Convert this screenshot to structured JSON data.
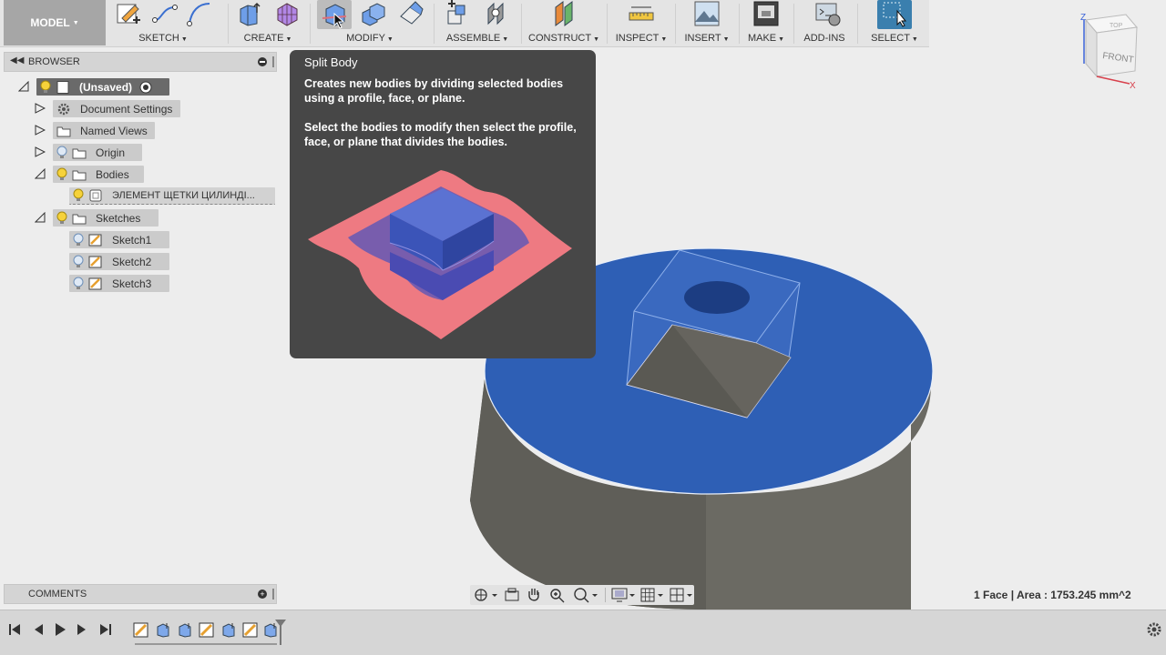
{
  "toolbar": {
    "workspace": "MODEL",
    "groups": {
      "sketch": "SKETCH",
      "create": "CREATE",
      "modify": "MODIFY",
      "assemble": "ASSEMBLE",
      "construct": "CONSTRUCT",
      "inspect": "INSPECT",
      "insert": "INSERT",
      "make": "MAKE",
      "addins": "ADD-INS",
      "select": "SELECT"
    }
  },
  "viewcube": {
    "top": "TOP",
    "front": "FRONT",
    "x": "X",
    "z": "Z"
  },
  "browser": {
    "title": "BROWSER",
    "items": {
      "root": "(Unsaved)",
      "doc_settings": "Document Settings",
      "named_views": "Named Views",
      "origin": "Origin",
      "bodies": "Bodies",
      "body1": "ЭЛЕМЕНТ ЩЕТКИ ЦИЛИНДІ...",
      "sketches": "Sketches",
      "sketch1": "Sketch1",
      "sketch2": "Sketch2",
      "sketch3": "Sketch3"
    }
  },
  "comments": {
    "title": "COMMENTS"
  },
  "tooltip": {
    "title": "Split Body",
    "description": "Creates new bodies by dividing selected bodies using a profile, face, or plane.",
    "instruction": "Select the bodies to modify then select the profile, face, or plane that divides the bodies."
  },
  "status": {
    "selection": "1 Face | Area : 1753.245 mm^2"
  },
  "colors": {
    "face_selected": "#2e5fb5",
    "body_gray": "#6b6a63",
    "tooltip_bg": "#474747",
    "illus_plane": "#ee7a82",
    "illus_box": "#3b54b8"
  }
}
